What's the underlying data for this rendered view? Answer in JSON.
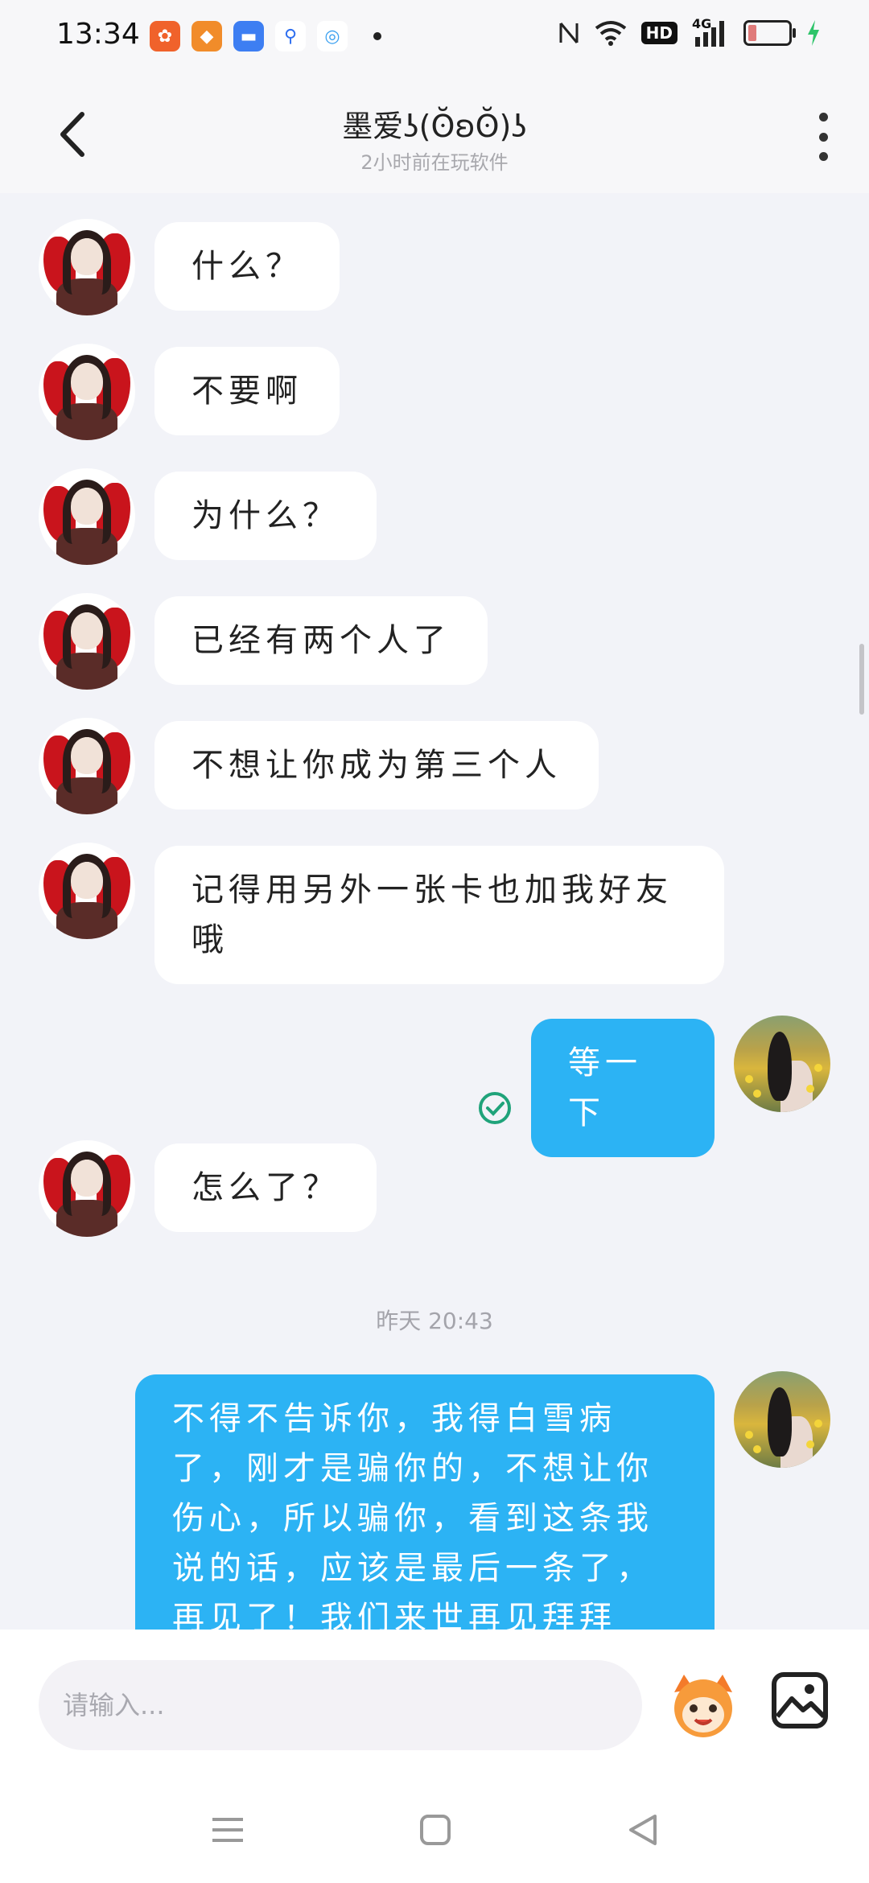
{
  "status_bar": {
    "time": "13:34",
    "right_hd": "HD",
    "right_net": "4G",
    "icons": [
      "nfc-icon",
      "wifi-icon",
      "hd-icon",
      "signal-icon",
      "battery-icon",
      "charging-icon"
    ]
  },
  "header": {
    "title": "墨爱ʖ(ʘ̆ʚʘ̆)ʖ",
    "subtitle": "2小时前在玩软件"
  },
  "messages": [
    {
      "side": "left",
      "text": "什么？"
    },
    {
      "side": "left",
      "text": "不要啊"
    },
    {
      "side": "left",
      "text": "为什么？"
    },
    {
      "side": "left",
      "text": "已经有两个人了"
    },
    {
      "side": "left",
      "text": "不想让你成为第三个人"
    },
    {
      "side": "left",
      "text": "记得用另外一张卡也加我好友哦"
    },
    {
      "side": "right",
      "text": "等一下",
      "status": "read"
    },
    {
      "side": "left",
      "text": "怎么了？"
    },
    {
      "side": "right",
      "text": "不得不告诉你，我得白雪病了，刚才是骗你的，不想让你伤心，所以骗你，看到这条我说的话，应该是最后一条了，再见了！我们来世再见拜拜"
    }
  ],
  "time_separator": "昨天 20:43",
  "input": {
    "placeholder": "请输入..."
  },
  "colors": {
    "bubble_right": "#2cb3f4",
    "bubble_left": "#ffffff",
    "background": "#f2f3f8",
    "read_check": "#1fa37a"
  }
}
